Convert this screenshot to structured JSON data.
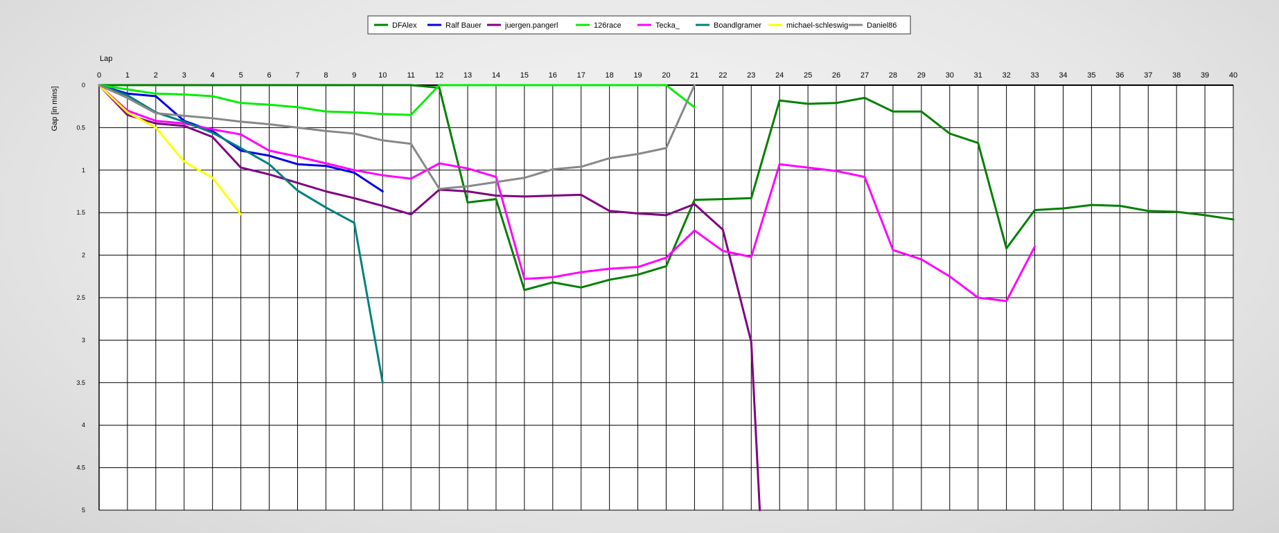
{
  "chart_data": {
    "type": "line",
    "xlabel": "Lap",
    "ylabel": "Gap [in mins]",
    "xlim": [
      0,
      40
    ],
    "ylim": [
      0,
      5
    ],
    "y_inverted": true,
    "grid": true,
    "legend_position": "top-center",
    "x_ticks": [
      0,
      1,
      2,
      3,
      4,
      5,
      6,
      7,
      8,
      9,
      10,
      11,
      12,
      13,
      14,
      15,
      16,
      17,
      18,
      19,
      20,
      21,
      22,
      23,
      24,
      25,
      26,
      27,
      28,
      29,
      30,
      31,
      32,
      33,
      34,
      35,
      36,
      37,
      38,
      39,
      40
    ],
    "y_ticks": [
      "0",
      "0.5",
      "1",
      "1.5",
      "2",
      "2.5",
      "3",
      "3.5",
      "4",
      "4.5",
      "5"
    ],
    "series": [
      {
        "name": "DFAlex",
        "color": "#008000",
        "x": [
          0,
          1,
          2,
          3,
          4,
          5,
          6,
          7,
          8,
          9,
          10,
          11,
          12,
          13,
          14,
          15,
          16,
          17,
          18,
          19,
          20,
          21,
          22,
          23,
          24,
          25,
          26,
          27,
          28,
          29,
          30,
          31,
          32,
          33,
          34,
          35,
          36,
          37,
          38,
          39,
          40
        ],
        "y": [
          0,
          0,
          0,
          0,
          0,
          0,
          0,
          0,
          0,
          0,
          0,
          0,
          0.03,
          1.38,
          1.34,
          2.41,
          2.32,
          2.38,
          2.29,
          2.23,
          2.13,
          1.35,
          1.34,
          1.33,
          0.18,
          0.22,
          0.21,
          0.15,
          0.31,
          0.31,
          0.57,
          0.68,
          1.92,
          1.47,
          1.45,
          1.41,
          1.42,
          1.48,
          1.49,
          1.53,
          1.58
        ]
      },
      {
        "name": "Ralf Bauer",
        "color": "#0000E6",
        "x": [
          0,
          1,
          2,
          3,
          4,
          5,
          6,
          7,
          8,
          9,
          10
        ],
        "y": [
          0,
          0.1,
          0.13,
          0.42,
          0.54,
          0.77,
          0.83,
          0.93,
          0.95,
          1.03,
          1.25
        ]
      },
      {
        "name": "juergen.pangerl",
        "color": "#800080",
        "x": [
          0,
          1,
          2,
          3,
          4,
          5,
          6,
          7,
          8,
          9,
          10,
          11,
          12,
          13,
          14,
          15,
          16,
          17,
          18,
          19,
          20,
          21,
          22,
          23,
          23.3
        ],
        "y": [
          0,
          0.35,
          0.45,
          0.48,
          0.61,
          0.97,
          1.05,
          1.15,
          1.25,
          1.33,
          1.42,
          1.52,
          1.23,
          1.25,
          1.3,
          1.31,
          1.3,
          1.29,
          1.48,
          1.51,
          1.53,
          1.4,
          1.7,
          3.02,
          5
        ]
      },
      {
        "name": "126race",
        "color": "#00EE00",
        "x": [
          0,
          1,
          2,
          3,
          4,
          5,
          6,
          7,
          8,
          9,
          10,
          11,
          12,
          13,
          14,
          15,
          16,
          17,
          18,
          19,
          20,
          21
        ],
        "y": [
          0,
          0.05,
          0.1,
          0.11,
          0.13,
          0.21,
          0.23,
          0.26,
          0.31,
          0.32,
          0.34,
          0.35,
          0,
          0,
          0,
          0,
          0,
          0,
          0,
          0,
          0,
          0.26
        ]
      },
      {
        "name": "Tecka_",
        "color": "#FF00FF",
        "x": [
          0,
          1,
          2,
          3,
          4,
          5,
          6,
          7,
          8,
          9,
          10,
          11,
          12,
          13,
          14,
          15,
          16,
          17,
          18,
          19,
          20,
          21,
          22,
          23,
          24,
          25,
          26,
          27,
          28,
          29,
          30,
          31,
          32,
          33
        ],
        "y": [
          0,
          0.3,
          0.42,
          0.45,
          0.52,
          0.58,
          0.77,
          0.84,
          0.92,
          1.0,
          1.06,
          1.1,
          0.92,
          0.98,
          1.08,
          2.28,
          2.26,
          2.2,
          2.16,
          2.14,
          2.03,
          1.71,
          1.95,
          2.02,
          0.93,
          0.97,
          1.01,
          1.08,
          1.94,
          2.05,
          2.25,
          2.5,
          2.54,
          1.9
        ]
      },
      {
        "name": "Boandlgramer",
        "color": "#008080",
        "x": [
          0,
          1,
          2,
          3,
          4,
          5,
          6,
          7,
          8,
          9,
          10
        ],
        "y": [
          0,
          0.12,
          0.32,
          0.43,
          0.56,
          0.74,
          0.93,
          1.24,
          1.44,
          1.62,
          3.5
        ]
      },
      {
        "name": "michael-schleswig",
        "color": "#FFFF00",
        "x": [
          0,
          1,
          2,
          3,
          4,
          5
        ],
        "y": [
          0,
          0.32,
          0.5,
          0.9,
          1.09,
          1.52
        ]
      },
      {
        "name": "Daniel86",
        "color": "#888888",
        "x": [
          0,
          1,
          2,
          3,
          4,
          5,
          6,
          7,
          8,
          9,
          10,
          11,
          12,
          13,
          14,
          15,
          16,
          17,
          18,
          19,
          20,
          21
        ],
        "y": [
          0,
          0.15,
          0.33,
          0.36,
          0.39,
          0.43,
          0.46,
          0.5,
          0.54,
          0.57,
          0.65,
          0.69,
          1.22,
          1.19,
          1.14,
          1.09,
          0.99,
          0.96,
          0.86,
          0.81,
          0.74,
          0
        ]
      }
    ]
  }
}
